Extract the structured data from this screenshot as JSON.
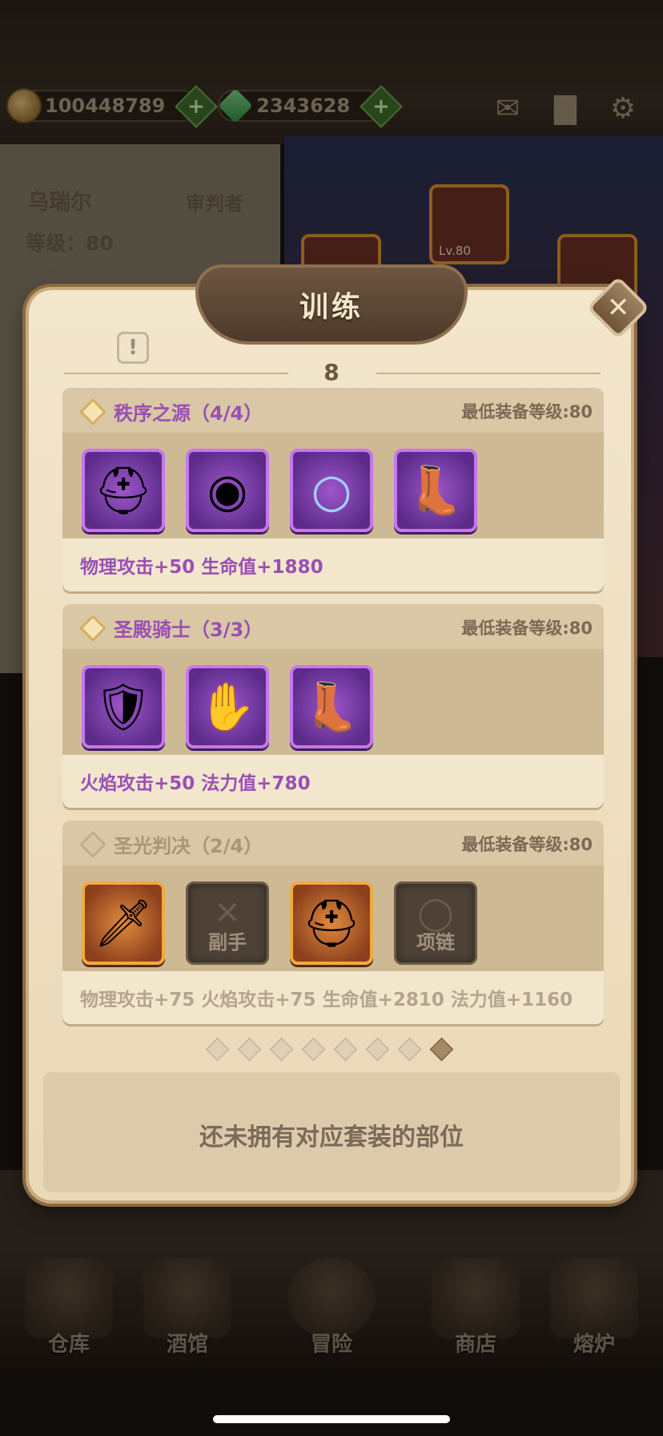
{
  "resources": [
    {
      "icon": "coin-icon",
      "value": "100448789"
    },
    {
      "icon": "gem-icon",
      "value": "2343628"
    }
  ],
  "top_icons": [
    "mail-icon",
    "book-icon",
    "gear-icon"
  ],
  "hero": {
    "name": "乌瑞尔",
    "role": "审判者",
    "level": "等级：80",
    "card_level": "Lv.80"
  },
  "modal": {
    "title": "训练",
    "page": "8",
    "sets": [
      {
        "name": "秩序之源（4/4）",
        "min_level": "最低装备等级:80",
        "active": true,
        "slots": [
          {
            "icon": "helmet-icon",
            "rarity": "purple"
          },
          {
            "icon": "amulet-icon",
            "rarity": "purple"
          },
          {
            "icon": "ring-icon",
            "rarity": "purple"
          },
          {
            "icon": "boot-icon",
            "rarity": "purple"
          }
        ],
        "bonus": "物理攻击+50  生命值+1880"
      },
      {
        "name": "圣殿骑士（3/3）",
        "min_level": "最低装备等级:80",
        "active": true,
        "slots": [
          {
            "icon": "armor-icon",
            "rarity": "purple"
          },
          {
            "icon": "gauntlet-icon",
            "rarity": "purple"
          },
          {
            "icon": "boot-icon",
            "rarity": "purple"
          }
        ],
        "bonus": "火焰攻击+50  法力值+780"
      },
      {
        "name": "圣光判决（2/4）",
        "min_level": "最低装备等级:80",
        "active": false,
        "slots": [
          {
            "icon": "sword-icon",
            "rarity": "gold"
          },
          {
            "icon": "offhand-placeholder-icon",
            "rarity": "empty",
            "label": "副手"
          },
          {
            "icon": "helmet-icon",
            "rarity": "gold"
          },
          {
            "icon": "necklace-placeholder-icon",
            "rarity": "empty",
            "label": "项链"
          }
        ],
        "bonus": "物理攻击+75  火焰攻击+75  生命值+2810  法力值+1160"
      }
    ],
    "page_dots": 8,
    "active_dot": 8,
    "empty_message": "还未拥有对应套装的部位"
  },
  "nav": [
    {
      "label": "仓库",
      "icon": "warehouse-icon"
    },
    {
      "label": "酒馆",
      "icon": "tavern-icon"
    },
    {
      "label": "冒险",
      "icon": "adventure-icon"
    },
    {
      "label": "商店",
      "icon": "shop-icon"
    },
    {
      "label": "熔炉",
      "icon": "forge-icon"
    }
  ]
}
